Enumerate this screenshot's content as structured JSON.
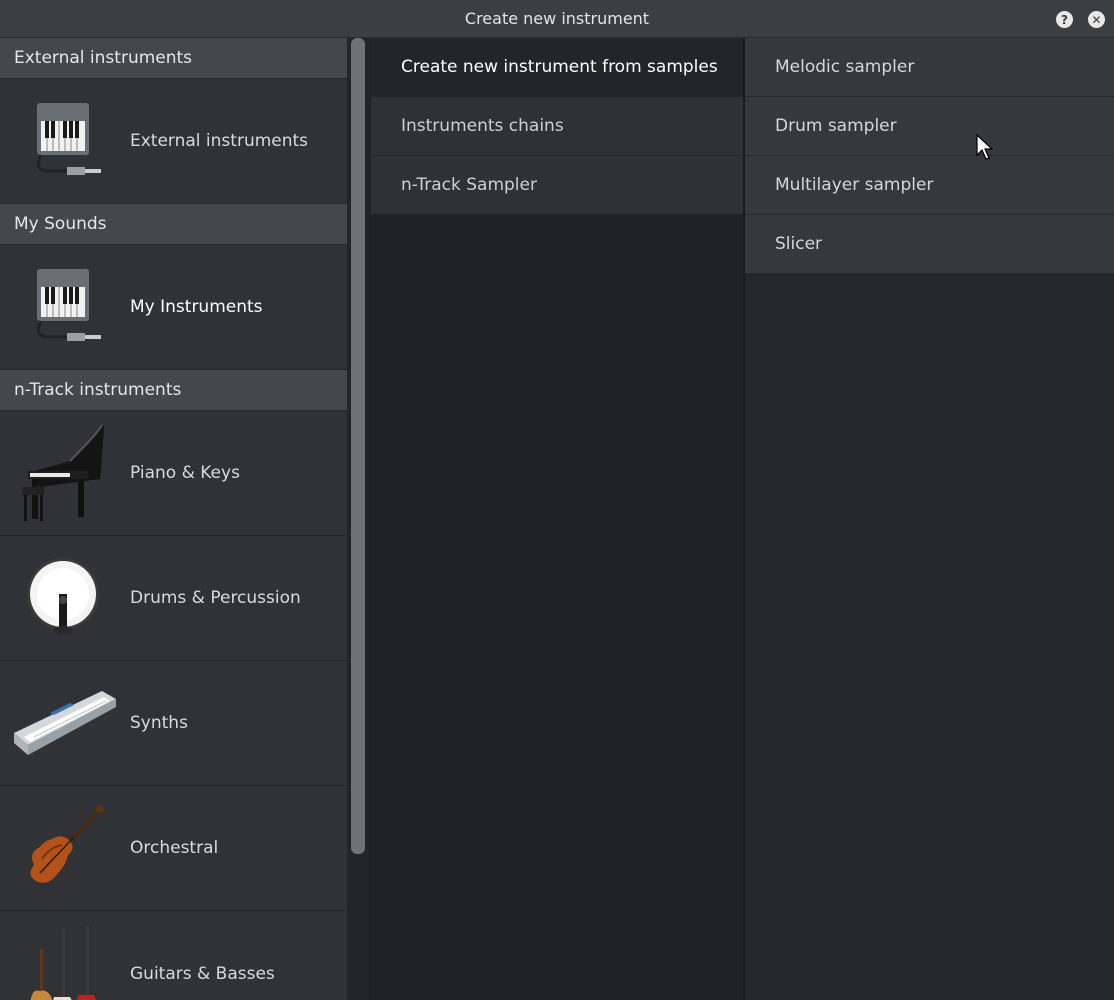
{
  "window": {
    "title": "Create new instrument",
    "help_glyph": "?",
    "close_glyph": "✕"
  },
  "sidebar": {
    "sections": [
      {
        "header": "External instruments",
        "items": [
          {
            "label": "External instruments",
            "icon": "piano-plug-icon"
          }
        ]
      },
      {
        "header": "My Sounds",
        "items": [
          {
            "label": "My Instruments",
            "icon": "piano-plug-icon",
            "active": true
          }
        ]
      },
      {
        "header": "n-Track instruments",
        "items": [
          {
            "label": "Piano & Keys",
            "icon": "grand-piano-icon"
          },
          {
            "label": "Drums & Percussion",
            "icon": "bass-drum-icon"
          },
          {
            "label": "Synths",
            "icon": "synth-keyboard-icon"
          },
          {
            "label": "Orchestral",
            "icon": "violin-icon"
          },
          {
            "label": "Guitars & Basses",
            "icon": "guitars-icon"
          }
        ]
      }
    ]
  },
  "middle": {
    "items": [
      {
        "label": "Create new instrument from samples",
        "selected": true
      },
      {
        "label": "Instruments chains"
      },
      {
        "label": "n-Track Sampler"
      }
    ]
  },
  "right": {
    "items": [
      {
        "label": "Melodic sampler"
      },
      {
        "label": "Drum sampler"
      },
      {
        "label": "Multilayer sampler"
      },
      {
        "label": "Slicer"
      }
    ]
  }
}
